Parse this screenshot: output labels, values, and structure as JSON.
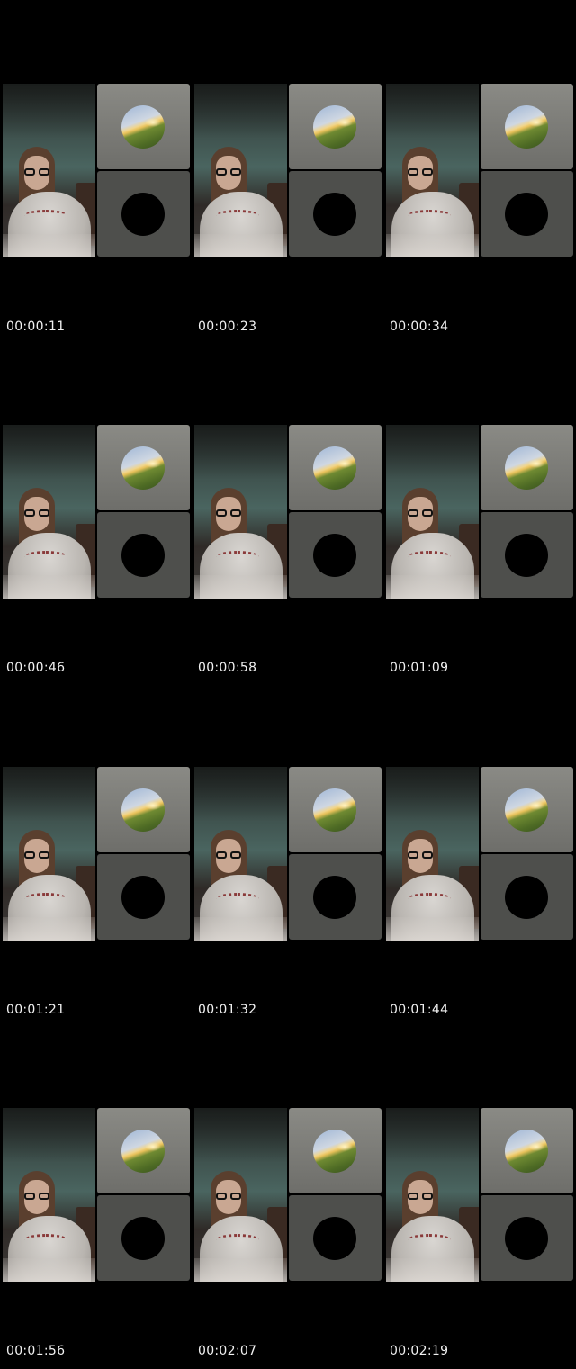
{
  "frames": [
    {
      "timestamp": "00:00:11"
    },
    {
      "timestamp": "00:00:23"
    },
    {
      "timestamp": "00:00:34"
    },
    {
      "timestamp": "00:00:46"
    },
    {
      "timestamp": "00:00:58"
    },
    {
      "timestamp": "00:01:09"
    },
    {
      "timestamp": "00:01:21"
    },
    {
      "timestamp": "00:01:32"
    },
    {
      "timestamp": "00:01:44"
    },
    {
      "timestamp": "00:01:56"
    },
    {
      "timestamp": "00:02:07"
    },
    {
      "timestamp": "00:02:19"
    }
  ],
  "colors": {
    "background": "#000000",
    "tile": "#5f605c",
    "timestamp_text": "#f2f2f2"
  },
  "icons": {
    "top_avatar": "sunset-avatar-icon",
    "bottom_avatar": "blank-avatar-icon"
  }
}
